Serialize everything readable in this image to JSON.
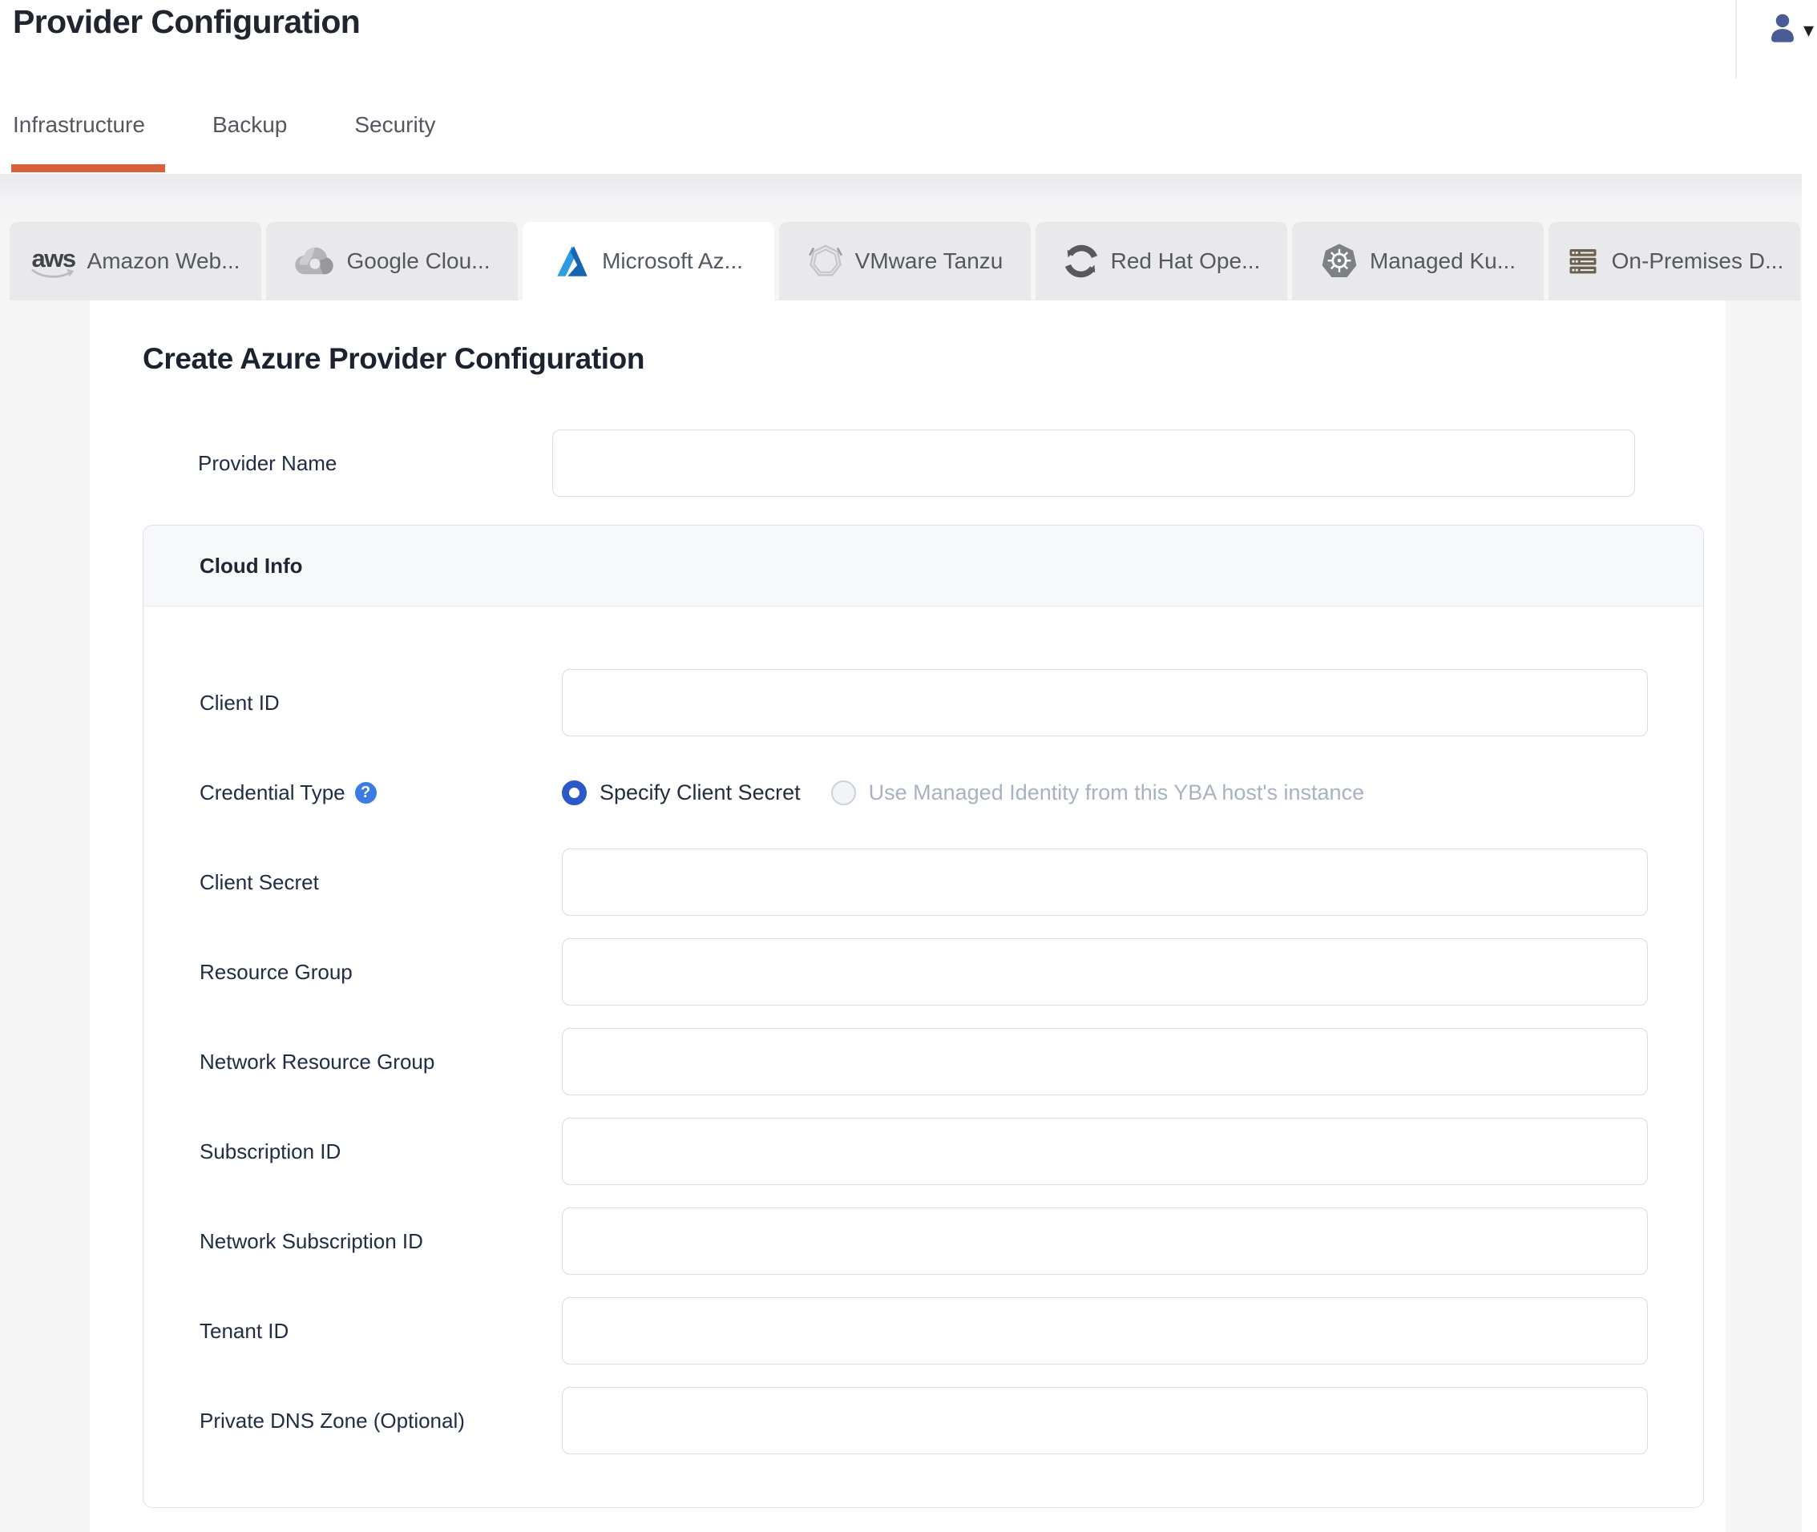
{
  "header": {
    "title": "Provider Configuration",
    "user_icon": "user-icon",
    "caret": "▾"
  },
  "nav_tabs": [
    {
      "label": "Infrastructure",
      "active": true
    },
    {
      "label": "Backup",
      "active": false
    },
    {
      "label": "Security",
      "active": false
    }
  ],
  "provider_tabs": [
    {
      "label": "Amazon Web...",
      "icon": "aws-icon",
      "active": false
    },
    {
      "label": "Google Clou...",
      "icon": "google-cloud-icon",
      "active": false
    },
    {
      "label": "Microsoft Az...",
      "icon": "azure-icon",
      "active": true
    },
    {
      "label": "VMware Tanzu",
      "icon": "vmware-tanzu-icon",
      "active": false
    },
    {
      "label": "Red Hat Ope...",
      "icon": "openshift-icon",
      "active": false
    },
    {
      "label": "Managed Ku...",
      "icon": "kubernetes-icon",
      "active": false
    },
    {
      "label": "On-Premises D...",
      "icon": "server-rack-icon",
      "active": false
    }
  ],
  "form": {
    "heading": "Create Azure Provider Configuration",
    "section": {
      "cloud_info_title": "Cloud Info"
    },
    "rows": {
      "provider_name": {
        "label": "Provider Name",
        "value": ""
      },
      "client_id": {
        "label": "Client ID",
        "value": ""
      },
      "credential_type": {
        "label": "Credential Type",
        "help_icon": "?",
        "options": [
          {
            "label": "Specify Client Secret",
            "selected": true,
            "disabled": false
          },
          {
            "label": "Use Managed Identity from this YBA host's instance",
            "selected": false,
            "disabled": true
          }
        ]
      },
      "client_secret": {
        "label": "Client Secret",
        "value": ""
      },
      "resource_group": {
        "label": "Resource Group",
        "value": ""
      },
      "network_resource_group": {
        "label": "Network Resource Group",
        "value": ""
      },
      "subscription_id": {
        "label": "Subscription ID",
        "value": ""
      },
      "network_subscription_id": {
        "label": "Network Subscription ID",
        "value": ""
      },
      "tenant_id": {
        "label": "Tenant ID",
        "value": ""
      },
      "private_dns_zone": {
        "label": "Private DNS Zone (Optional)",
        "value": ""
      }
    }
  },
  "colors": {
    "accent_orange": "#d9603a",
    "radio_selected_blue": "#2b59c9",
    "help_icon_blue": "#3b7ce2",
    "user_icon_indigo": "#4a5b96",
    "azure_blue_light": "#2d9ce2",
    "azure_blue_dark": "#1565b4",
    "page_background": "#f5f5f6",
    "provider_tab_background": "#e9e9eb"
  }
}
